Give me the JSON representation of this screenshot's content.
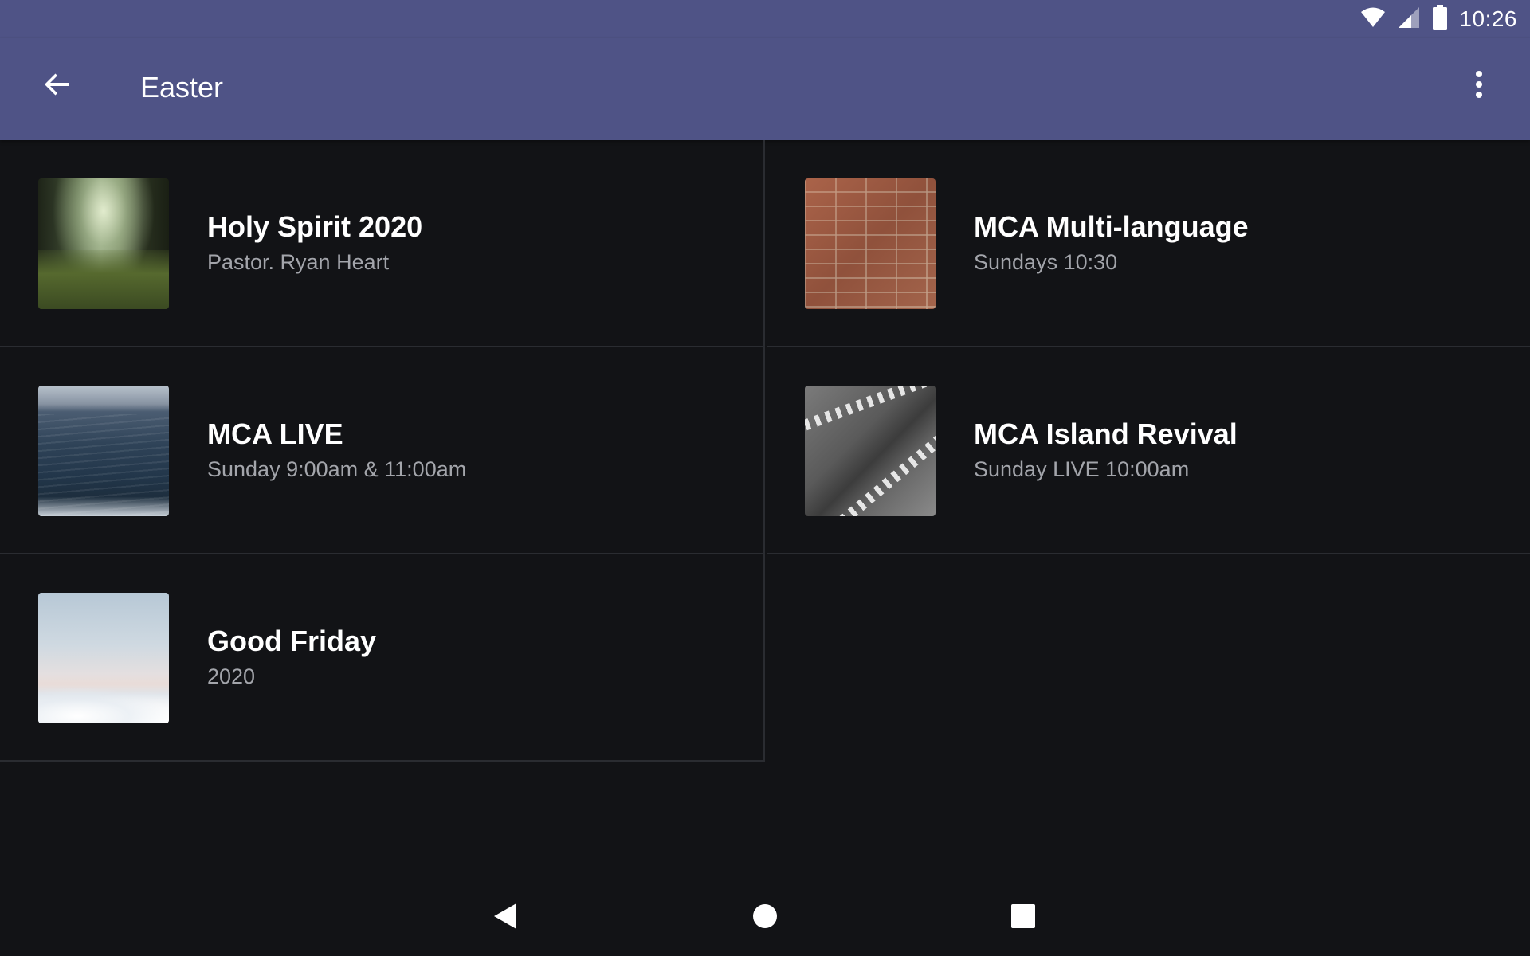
{
  "status_bar": {
    "time": "10:26",
    "icons": [
      "wifi-icon",
      "signal-icon",
      "battery-icon"
    ],
    "background": "#4f5386"
  },
  "app_bar": {
    "title": "Easter",
    "back_icon": "arrow-back-icon",
    "menu_icon": "more-vert-icon",
    "background": "#4f5386"
  },
  "items": [
    {
      "title": "Holy Spirit 2020",
      "subtitle": "Pastor. Ryan Heart",
      "thumbnail": "forest-image"
    },
    {
      "title": "MCA Multi-language",
      "subtitle": "Sundays 10:30",
      "thumbnail": "brick-wall-image"
    },
    {
      "title": "MCA LIVE",
      "subtitle": "Sunday 9:00am & 11:00am",
      "thumbnail": "ocean-image"
    },
    {
      "title": "MCA Island Revival",
      "subtitle": "Sunday LIVE 10:00am",
      "thumbnail": "road-image"
    },
    {
      "title": "Good Friday",
      "subtitle": "2020",
      "thumbnail": "clouds-image"
    }
  ],
  "nav_bar": {
    "back_icon": "nav-back-icon",
    "home_icon": "nav-home-icon",
    "recents_icon": "nav-recents-icon"
  },
  "colors": {
    "background": "#121316",
    "primary": "#4f5386",
    "title_text": "#ffffff",
    "subtitle_text": "#a3a5ab",
    "divider": "#2a2c31"
  }
}
